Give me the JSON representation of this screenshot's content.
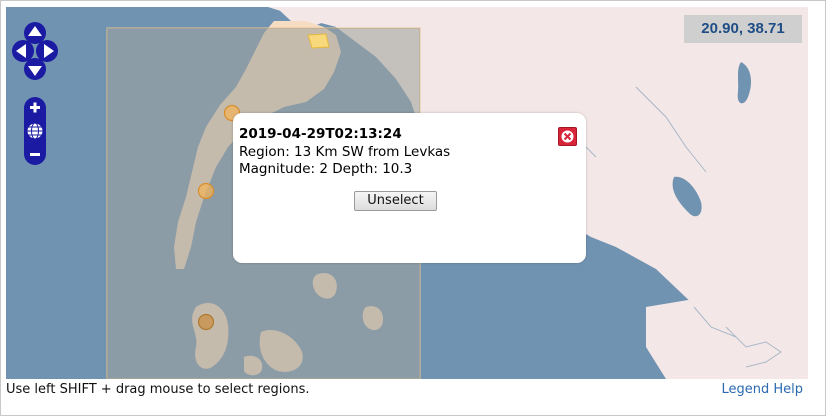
{
  "map": {
    "coordinates": "20.90, 38.71",
    "colors": {
      "sea": "#7193b2",
      "land": "#f4e7e7",
      "island": "#f7dcc4",
      "selection": "#f0dcc0",
      "event_marker": "#f0b35c",
      "highlight": "#f7d87a"
    },
    "controls": {
      "pan_up": "pan-up-icon",
      "pan_down": "pan-down-icon",
      "pan_left": "pan-left-icon",
      "pan_right": "pan-right-icon",
      "zoom_in": "zoom-in-icon",
      "zoom_world": "globe-icon",
      "zoom_out": "zoom-out-icon"
    }
  },
  "popup": {
    "datetime": "2019-04-29T02:13:24",
    "region": "Region: 13 Km SW from Levkas",
    "magnitude_depth": "Magnitude: 2 Depth: 10.3",
    "unselect_label": "Unselect",
    "close_icon": "close-icon"
  },
  "footer": {
    "hint": "Use left SHIFT + drag mouse to select regions.",
    "legend_help": "Legend Help"
  }
}
